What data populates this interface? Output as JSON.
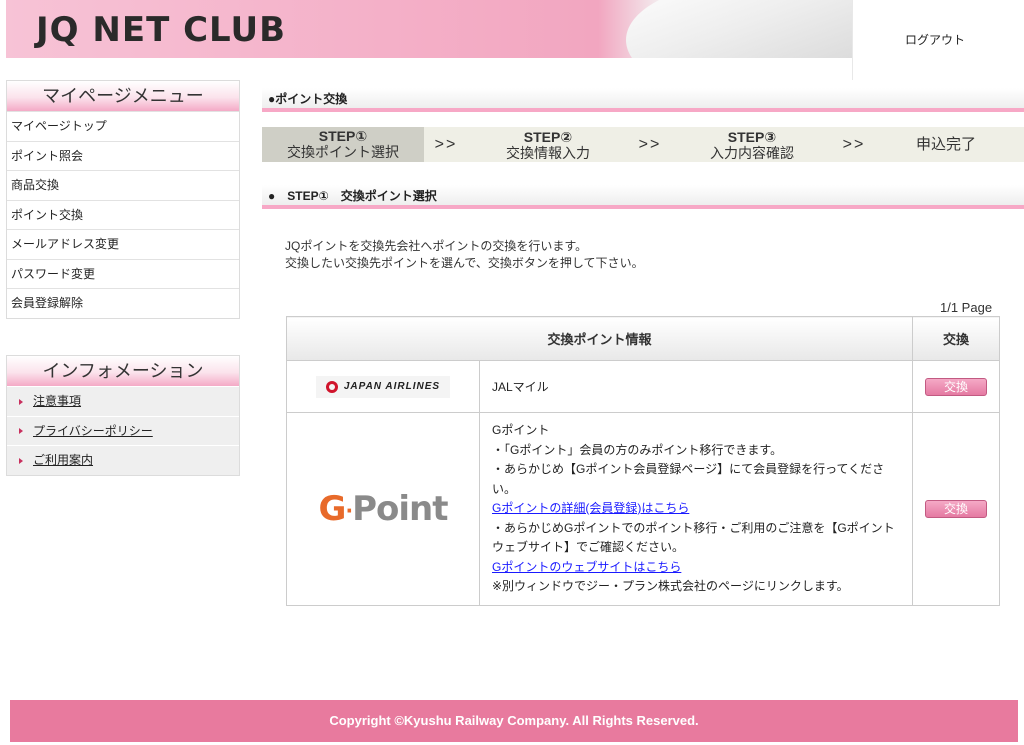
{
  "header": {
    "logo": "JQ NET CLUB",
    "logout": "ログアウト"
  },
  "sidebar": {
    "menu_title": "マイページメニュー",
    "menu_items": [
      {
        "label": "マイページトップ"
      },
      {
        "label": "ポイント照会"
      },
      {
        "label": "商品交換"
      },
      {
        "label": "ポイント交換"
      },
      {
        "label": "メールアドレス変更"
      },
      {
        "label": "パスワード変更"
      },
      {
        "label": "会員登録解除"
      }
    ],
    "info_title": "インフォメーション",
    "info_items": [
      {
        "label": "注意事項"
      },
      {
        "label": "プライバシーポリシー"
      },
      {
        "label": "ご利用案内"
      }
    ]
  },
  "main": {
    "section_title": "●ポイント交換",
    "steps": [
      {
        "num": "STEP①",
        "label": "交換ポイント選択"
      },
      {
        "num": "STEP②",
        "label": "交換情報入力"
      },
      {
        "num": "STEP③",
        "label": "入力内容確認"
      },
      {
        "num": "",
        "label": "申込完了"
      }
    ],
    "step_separator": ">>",
    "step_title": "●　STEP①　交換ポイント選択",
    "description_line1": "JQポイントを交換先会社へポイントの交換を行います。",
    "description_line2": "交換したい交換先ポイントを選んで、交換ボタンを押して下さい。",
    "page_info": "1/1  Page",
    "table": {
      "header_info": "交換ポイント情報",
      "header_exchange": "交換",
      "rows": [
        {
          "logo_text": "JAPAN AIRLINES",
          "name": "JALマイル",
          "button": "交換"
        },
        {
          "logo_text_g": "G",
          "logo_text_dot": "·",
          "logo_text_rest": "Point",
          "name": "Gポイント",
          "line1": "・「Gポイント」会員の方のみポイント移行できます。",
          "line2": "・あらかじめ【Gポイント会員登録ページ】にて会員登録を行ってください。",
          "link1": "Gポイントの詳細(会員登録)はこちら",
          "line3": "・あらかじめGポイントでのポイント移行・ご利用のご注意を【Gポイントウェブサイト】でご確認ください。",
          "link2": "Gポイントのウェブサイトはこちら",
          "note": "※別ウィンドウでジー・プラン株式会社のページにリンクします。",
          "button": "交換"
        }
      ]
    }
  },
  "footer": {
    "copyright": "Copyright ©Kyushu Railway Company. All Rights Reserved."
  }
}
